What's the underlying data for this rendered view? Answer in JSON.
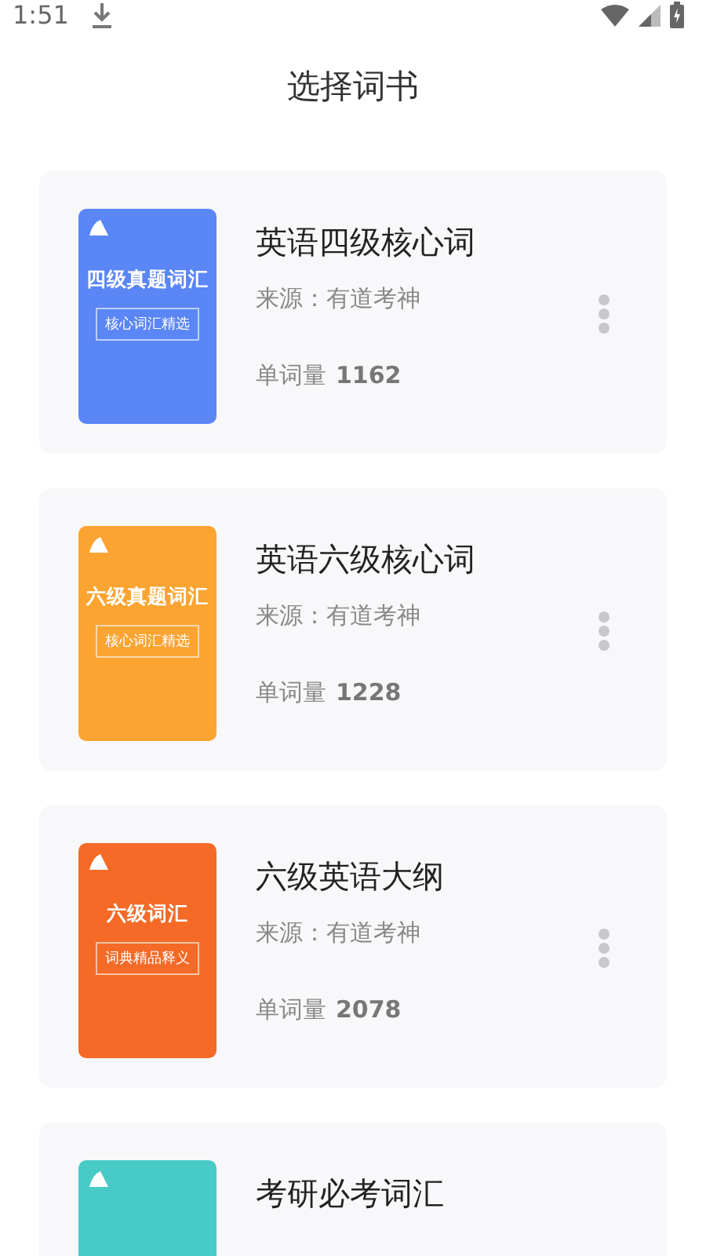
{
  "status_bar": {
    "time": "1:51"
  },
  "header": {
    "title": "选择词书"
  },
  "books": [
    {
      "title": "英语四级核心词",
      "source": "来源：有道考神",
      "count_label": "单词量",
      "count": "1162",
      "cover": {
        "color": "#5a86f6",
        "title": "四级真题词汇",
        "subtitle": "核心词汇精选"
      }
    },
    {
      "title": "英语六级核心词",
      "source": "来源：有道考神",
      "count_label": "单词量",
      "count": "1228",
      "cover": {
        "color": "#fca431",
        "title": "六级真题词汇",
        "subtitle": "核心词汇精选"
      }
    },
    {
      "title": "六级英语大纲",
      "source": "来源：有道考神",
      "count_label": "单词量",
      "count": "2078",
      "cover": {
        "color": "#f46a26",
        "title": "六级词汇",
        "subtitle": "词典精品释义"
      }
    },
    {
      "title": "考研必考词汇",
      "cover": {
        "color": "#48cac6"
      }
    }
  ]
}
